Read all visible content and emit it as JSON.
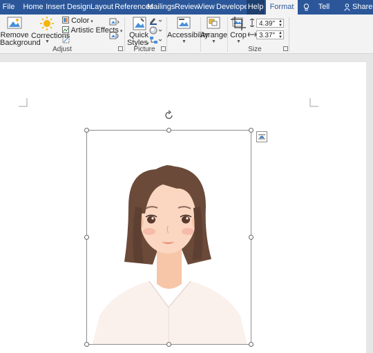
{
  "tabs": [
    {
      "id": "file",
      "label": "File"
    },
    {
      "id": "home",
      "label": "Home"
    },
    {
      "id": "insert",
      "label": "Insert"
    },
    {
      "id": "design",
      "label": "Design"
    },
    {
      "id": "layout",
      "label": "Layout"
    },
    {
      "id": "references",
      "label": "References"
    },
    {
      "id": "mailings",
      "label": "Mailings"
    },
    {
      "id": "review",
      "label": "Review"
    },
    {
      "id": "view",
      "label": "View"
    },
    {
      "id": "developer",
      "label": "Developer"
    },
    {
      "id": "help",
      "label": "Help"
    },
    {
      "id": "format",
      "label": "Format"
    }
  ],
  "tellme": "Tell me",
  "share": "Share",
  "ribbon": {
    "remove_bg": [
      "Remove",
      "Background"
    ],
    "corrections": "Corrections",
    "color": "Color",
    "artistic_effects": "Artistic Effects",
    "adjust_label": "Adjust",
    "quick_styles": [
      "Quick",
      "Styles"
    ],
    "picture_styles_label": "Picture Styles",
    "accessibility": "Accessibility",
    "arrange": "Arrange",
    "crop": "Crop",
    "height": "4.39\"",
    "width": "3.37\"",
    "size_label": "Size"
  },
  "colors": {
    "accent": "#2b579a",
    "help_tab": "#1e3f6e",
    "ribbon_bg": "#f3f3f3",
    "doc_bg": "#e6e6e6"
  }
}
